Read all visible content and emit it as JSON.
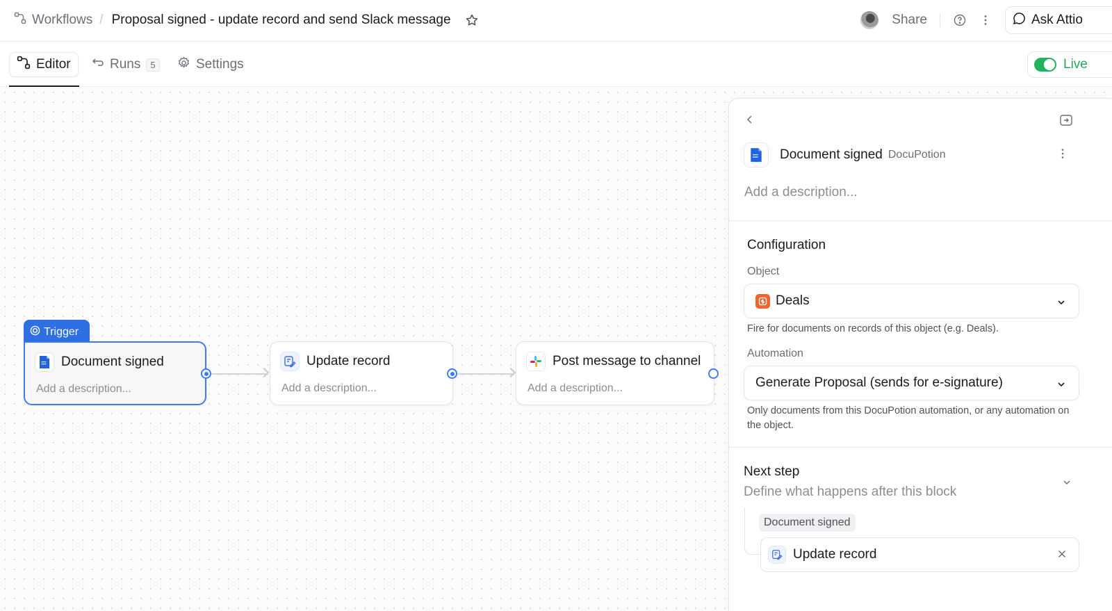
{
  "breadcrumb": {
    "root": "Workflows",
    "separator": "/",
    "title": "Proposal signed - update record and send Slack message"
  },
  "topbar": {
    "share_label": "Share",
    "ask_label": "Ask Attio"
  },
  "tabs": [
    {
      "label": "Editor",
      "active": true
    },
    {
      "label": "Runs",
      "count": "5"
    },
    {
      "label": "Settings"
    }
  ],
  "live": {
    "label": "Live",
    "enabled": true,
    "color": "#23a857"
  },
  "canvas": {
    "trigger_label": "Trigger",
    "nodes": [
      {
        "title": "Document signed",
        "description": "Add a description...",
        "icon": "docupotion-icon",
        "selected": true
      },
      {
        "title": "Update record",
        "description": "Add a description...",
        "icon": "update-record-icon"
      },
      {
        "title": "Post message to channel",
        "description": "Add a description...",
        "icon": "slack-icon"
      }
    ]
  },
  "panel": {
    "title": "Document signed",
    "subtitle": "DocuPotion",
    "description_placeholder": "Add a description...",
    "configuration": {
      "title": "Configuration",
      "object_label": "Object",
      "object_value": "Deals",
      "object_help": "Fire for documents on records of this object (e.g. Deals).",
      "automation_label": "Automation",
      "automation_value": "Generate Proposal (sends for e-signature)",
      "automation_help": "Only documents from this DocuPotion automation, or any automation on the object."
    },
    "next_step": {
      "title": "Next step",
      "subtitle": "Define what happens after this block",
      "from_chip": "Document signed",
      "item": "Update record"
    }
  },
  "colors": {
    "accent": "#3d7bef",
    "trigger": "#2f6fe4",
    "deals": "#f0642d",
    "live_green": "#23b35c"
  }
}
